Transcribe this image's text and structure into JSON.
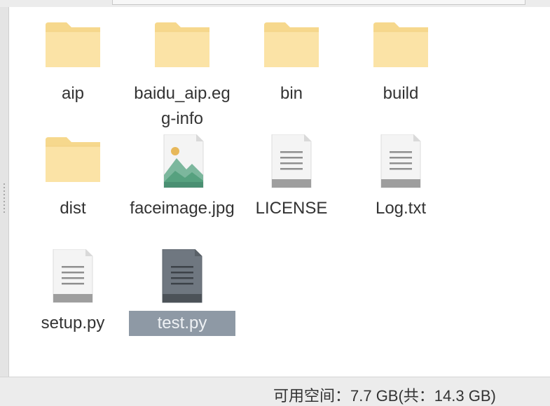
{
  "files": [
    {
      "name": "aip",
      "type": "folder",
      "icon": "folder-icon"
    },
    {
      "name": "baidu_aip.egg-info",
      "type": "folder",
      "icon": "folder-icon"
    },
    {
      "name": "bin",
      "type": "folder",
      "icon": "folder-icon"
    },
    {
      "name": "build",
      "type": "folder",
      "icon": "folder-icon"
    },
    {
      "name": "dist",
      "type": "folder",
      "icon": "folder-icon"
    },
    {
      "name": "faceimage.jpg",
      "type": "image",
      "icon": "image-file-icon"
    },
    {
      "name": "LICENSE",
      "type": "text",
      "icon": "text-file-icon"
    },
    {
      "name": "Log.txt",
      "type": "text",
      "icon": "text-file-icon"
    },
    {
      "name": "setup.py",
      "type": "text",
      "icon": "text-file-icon"
    },
    {
      "name": "test.py",
      "type": "text",
      "icon": "text-file-icon",
      "selected": true
    }
  ],
  "status": {
    "free_space": "可用空间：7.7 GB(共：14.3 GB)"
  },
  "colors": {
    "folder_fill": "#fbe3a6",
    "folder_tab": "#f6d88d",
    "selection": "#8e99a5",
    "file_paper": "#f4f4f4",
    "file_bottom": "#9e9e9e"
  }
}
